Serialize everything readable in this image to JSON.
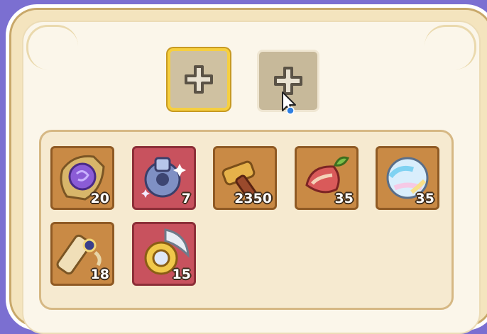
{
  "slots": [
    {
      "name": "plus-slot-1",
      "icon": "plus-icon",
      "state": "selected"
    },
    {
      "name": "plus-slot-2",
      "icon": "plus-icon",
      "state": "normal"
    }
  ],
  "items": [
    {
      "name": "purple-orb-scroll",
      "count": "20",
      "rarity": "common"
    },
    {
      "name": "crystal-gear",
      "count": "7",
      "rarity": "epic"
    },
    {
      "name": "wooden-hammer",
      "count": "2350",
      "rarity": "common"
    },
    {
      "name": "berry-fruit",
      "count": "35",
      "rarity": "common"
    },
    {
      "name": "rainbow-orb",
      "count": "35",
      "rarity": "common"
    },
    {
      "name": "jeweled-scroll",
      "count": "18",
      "rarity": "common"
    },
    {
      "name": "gold-ring-feather",
      "count": "15",
      "rarity": "epic"
    }
  ],
  "colors": {
    "selected_border": "#f6cf3f",
    "common_tile": "#c98a45",
    "epic_tile": "#c8525e"
  }
}
